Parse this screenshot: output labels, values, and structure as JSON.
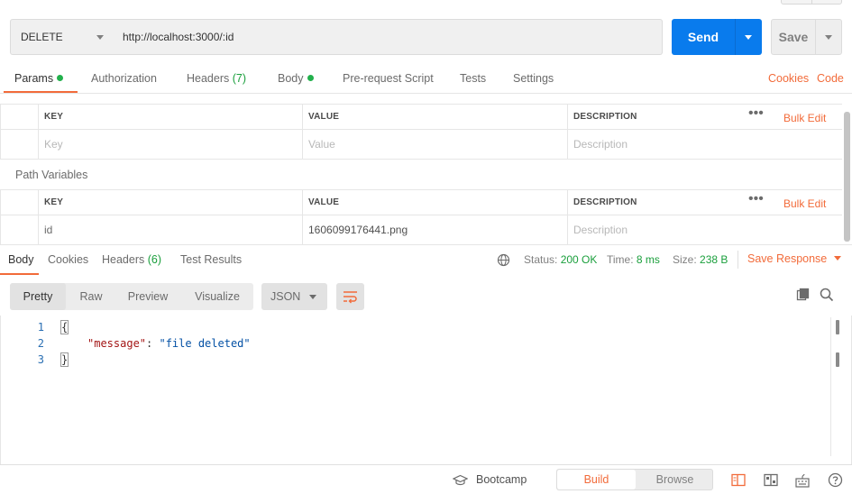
{
  "request": {
    "method": "DELETE",
    "url": "http://localhost:3000/:id",
    "send_label": "Send",
    "save_label": "Save"
  },
  "request_tabs": [
    {
      "label": "Params",
      "count": "",
      "dot": true,
      "active": true
    },
    {
      "label": "Authorization",
      "count": "",
      "dot": false,
      "active": false
    },
    {
      "label": "Headers",
      "count": "(7)",
      "dot": false,
      "active": false
    },
    {
      "label": "Body",
      "count": "",
      "dot": true,
      "active": false
    },
    {
      "label": "Pre-request Script",
      "count": "",
      "dot": false,
      "active": false
    },
    {
      "label": "Tests",
      "count": "",
      "dot": false,
      "active": false
    },
    {
      "label": "Settings",
      "count": "",
      "dot": false,
      "active": false
    }
  ],
  "request_links": {
    "cookies": "Cookies",
    "code": "Code"
  },
  "query_params": {
    "headers": {
      "key": "KEY",
      "value": "VALUE",
      "description": "DESCRIPTION"
    },
    "bulk_edit": "Bulk Edit",
    "placeholder_row": {
      "key": "Key",
      "value": "Value",
      "description": "Description"
    }
  },
  "path_variables": {
    "title": "Path Variables",
    "headers": {
      "key": "KEY",
      "value": "VALUE",
      "description": "DESCRIPTION"
    },
    "bulk_edit": "Bulk Edit",
    "rows": [
      {
        "key": "id",
        "value": "1606099176441.png",
        "description": "Description"
      }
    ]
  },
  "response_tabs": [
    {
      "label": "Body",
      "count": "",
      "active": true
    },
    {
      "label": "Cookies",
      "count": "",
      "active": false
    },
    {
      "label": "Headers",
      "count": "(6)",
      "active": false
    },
    {
      "label": "Test Results",
      "count": "",
      "active": false
    }
  ],
  "response_meta": {
    "status_label": "Status:",
    "status_value": "200 OK",
    "time_label": "Time:",
    "time_value": "8 ms",
    "size_label": "Size:",
    "size_value": "238 B",
    "save_response": "Save Response"
  },
  "viewer": {
    "modes": [
      "Pretty",
      "Raw",
      "Preview",
      "Visualize"
    ],
    "active_mode": "Pretty",
    "format": "JSON"
  },
  "code_lines": [
    {
      "num": "1",
      "text": "{"
    },
    {
      "num": "2",
      "key": "\"message\"",
      "sep": ": ",
      "value": "\"file deleted\""
    },
    {
      "num": "3",
      "text": "}"
    }
  ],
  "statusbar": {
    "bootcamp": "Bootcamp",
    "build": "Build",
    "browse": "Browse"
  },
  "colors": {
    "accent": "#f26b3a",
    "primary": "#097bed",
    "success": "#1a9f3c"
  }
}
